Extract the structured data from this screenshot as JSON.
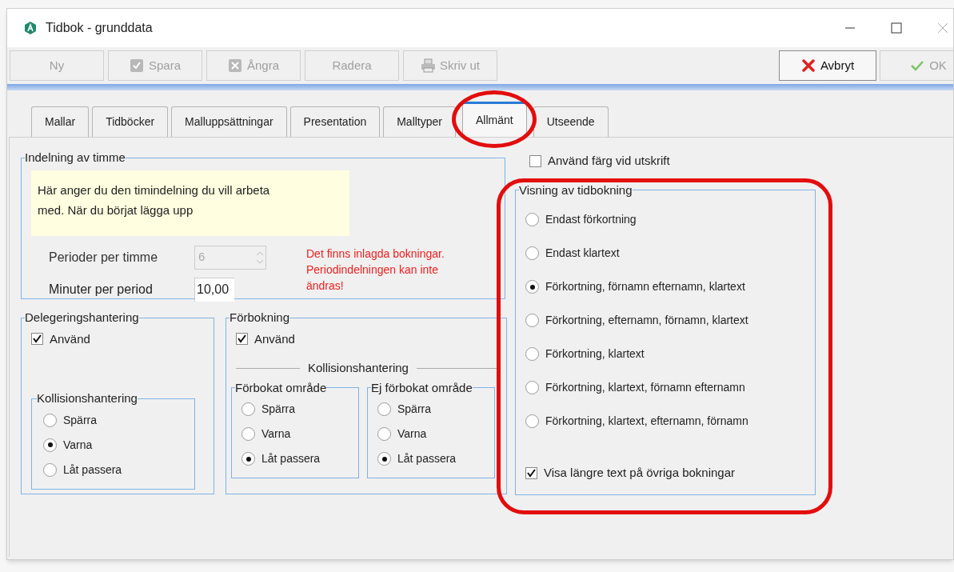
{
  "window": {
    "title": "Tidbok - grunddata"
  },
  "toolbar": {
    "left": [
      {
        "label": "Ny",
        "kind": "plain",
        "disabled": true
      },
      {
        "label": "Spara",
        "kind": "save",
        "disabled": true
      },
      {
        "label": "Ångra",
        "kind": "undo",
        "disabled": true
      },
      {
        "label": "Radera",
        "kind": "plain",
        "disabled": true
      },
      {
        "label": "Skriv ut",
        "kind": "print",
        "disabled": true
      }
    ],
    "right": [
      {
        "label": "Avbryt",
        "kind": "cancel",
        "disabled": false
      },
      {
        "label": "OK",
        "kind": "ok",
        "disabled": true
      }
    ]
  },
  "tabs": [
    {
      "label": "Mallar",
      "selected": false
    },
    {
      "label": "Tidböcker",
      "selected": false
    },
    {
      "label": "Malluppsättningar",
      "selected": false
    },
    {
      "label": "Presentation",
      "selected": false
    },
    {
      "label": "Malltyper",
      "selected": false
    },
    {
      "label": "Allmänt",
      "selected": true
    },
    {
      "label": "Utseende",
      "selected": false
    }
  ],
  "indelning": {
    "title": "Indelning av timme",
    "info": "Här anger du den timindelning du vill arbeta med. När du börjat lägga upp",
    "fields": [
      {
        "label": "Perioder per timme",
        "value": "6",
        "disabled": true,
        "kind": "spin"
      },
      {
        "label": "Minuter per period",
        "value": "10,00",
        "disabled": false,
        "kind": "text"
      }
    ],
    "warning": "Det finns inlagda bokningar. Periodindelningen kan inte ändras!"
  },
  "delegering": {
    "title": "Delegeringshantering",
    "checkbox": {
      "label": "Använd",
      "checked": true
    },
    "group": {
      "title": "Kollisionshantering",
      "options": [
        {
          "label": "Spärra",
          "selected": false
        },
        {
          "label": "Varna",
          "selected": true
        },
        {
          "label": "Låt passera",
          "selected": false
        }
      ]
    }
  },
  "forbokning": {
    "title": "Förbokning",
    "checkbox": {
      "label": "Använd",
      "checked": true
    },
    "separator": "Kollisionshantering",
    "groups": [
      {
        "title": "Förbokat område",
        "options": [
          {
            "label": "Spärra",
            "selected": false
          },
          {
            "label": "Varna",
            "selected": false
          },
          {
            "label": "Låt passera",
            "selected": true
          }
        ]
      },
      {
        "title": "Ej förbokat område",
        "options": [
          {
            "label": "Spärra",
            "selected": false
          },
          {
            "label": "Varna",
            "selected": false
          },
          {
            "label": "Låt passera",
            "selected": true
          }
        ]
      }
    ]
  },
  "color_print": {
    "label": "Använd färg vid utskrift",
    "checked": false
  },
  "visning": {
    "title": "Visning av tidbokning",
    "options": [
      {
        "label": "Endast förkortning",
        "selected": false
      },
      {
        "label": "Endast klartext",
        "selected": false
      },
      {
        "label": "Förkortning, förnamn efternamn, klartext",
        "selected": true
      },
      {
        "label": "Förkortning, efternamn, förnamn, klartext",
        "selected": false
      },
      {
        "label": "Förkortning, klartext",
        "selected": false
      },
      {
        "label": "Förkortning, klartext, förnamn efternamn",
        "selected": false
      },
      {
        "label": "Förkortning, klartext, efternamn, förnamn",
        "selected": false
      }
    ],
    "checkbox": {
      "label": "Visa längre text på övriga bokningar",
      "checked": true
    }
  },
  "annotations": [
    {
      "kind": "ellipse"
    },
    {
      "kind": "rounded-rect"
    }
  ]
}
